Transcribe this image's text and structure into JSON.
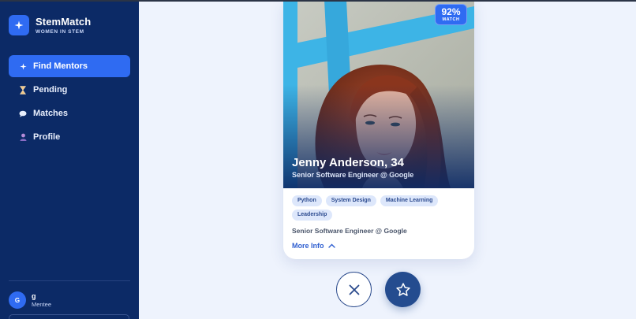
{
  "brand": {
    "name": "StemMatch",
    "tagline": "WOMEN IN STEM"
  },
  "nav": [
    {
      "label": "Find Mentors",
      "icon": "sparkle-icon",
      "active": true
    },
    {
      "label": "Pending",
      "icon": "hourglass-icon",
      "active": false
    },
    {
      "label": "Matches",
      "icon": "chat-bubble-icon",
      "active": false
    },
    {
      "label": "Profile",
      "icon": "person-icon",
      "active": false
    }
  ],
  "user": {
    "initial": "G",
    "name": "g",
    "role": "Mentee"
  },
  "card": {
    "match": {
      "value": "92%",
      "label": "MATCH",
      "fraction": 0.92
    },
    "name": "Jenny Anderson, 34",
    "headline": "Senior Software Engineer @ Google",
    "tags": [
      "Python",
      "System Design",
      "Machine Learning",
      "Leadership"
    ],
    "bio": "Senior Software Engineer @ Google",
    "more_label": "More Info"
  },
  "actions": {
    "pass_icon": "close-icon",
    "favorite_icon": "star-icon"
  },
  "colors": {
    "sidebar": "#0c2a66",
    "accent": "#2f6bf2",
    "background": "#eef3fd",
    "tag_bg": "#dde7fb",
    "action_dark": "#244c8f"
  }
}
